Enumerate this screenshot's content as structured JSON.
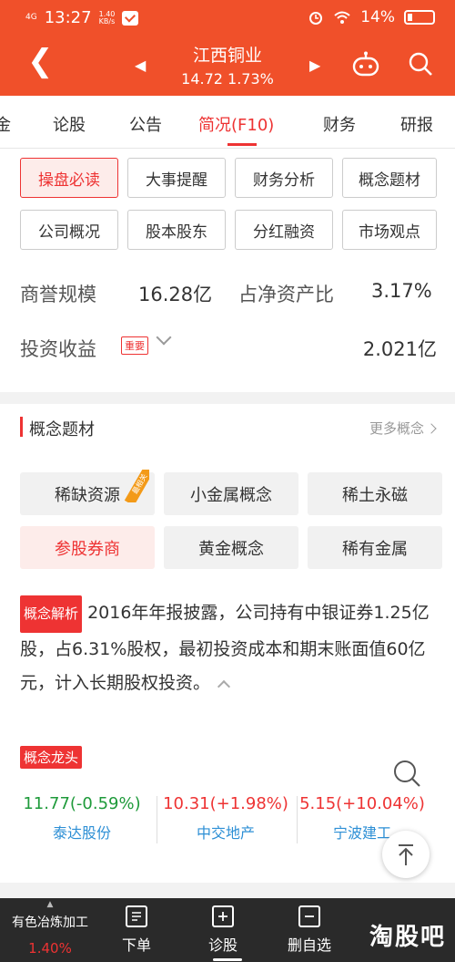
{
  "status_bar": {
    "network": "4G",
    "time": "13:27",
    "speed_value": "1.40",
    "speed_unit": "KB/s",
    "battery": "14%"
  },
  "header": {
    "stock_name": "江西铜业",
    "quote": "14.72  1.73%"
  },
  "tabs": [
    {
      "label": "金"
    },
    {
      "label": "论股"
    },
    {
      "label": "公告"
    },
    {
      "label": "简况(F10)",
      "active": true
    },
    {
      "label": "财务"
    },
    {
      "label": "研报"
    }
  ],
  "grid_buttons": [
    "操盘必读",
    "大事提醒",
    "财务分析",
    "概念题材",
    "公司概况",
    "股本股东",
    "分红融资",
    "市场观点"
  ],
  "metrics": {
    "goodwill_label": "商誉规模",
    "goodwill_value": "16.28亿",
    "ratio_label": "占净资产比",
    "ratio_value": "3.17%",
    "invest_label": "投资收益",
    "invest_badge": "重要",
    "invest_value": "2.021亿"
  },
  "concepts": {
    "title": "概念题材",
    "more": "更多概念",
    "items": [
      "稀缺资源",
      "小金属概念",
      "稀土永磁",
      "参股券商",
      "黄金概念",
      "稀有金属"
    ],
    "ribbon": "最相关",
    "analysis_tag": "概念解析",
    "analysis_text": "2016年年报披露，公司持有中银证券1.25亿股，占6.31%股权，最初投资成本和期末账面值60亿元，计入长期股权投资。",
    "leader_tag": "概念龙头",
    "leaders": [
      {
        "quote": "11.77(-0.59%)",
        "name": "泰达股份",
        "trend": "down"
      },
      {
        "quote": "10.31(+1.98%)",
        "name": "中交地产",
        "trend": "up"
      },
      {
        "quote": "5.15(+10.04%)",
        "name": "宁波建工",
        "trend": "up"
      }
    ]
  },
  "bottom_bar": {
    "sector_name": "有色冶炼加工",
    "sector_pct": "1.40%",
    "items": [
      "下单",
      "诊股",
      "删自选"
    ],
    "watermark": "淘股吧"
  },
  "colors": {
    "brand": "#f0502a",
    "accent_red": "#e33333",
    "up": "#e33333",
    "down": "#1e9a3a",
    "link": "#2d8fd5"
  }
}
